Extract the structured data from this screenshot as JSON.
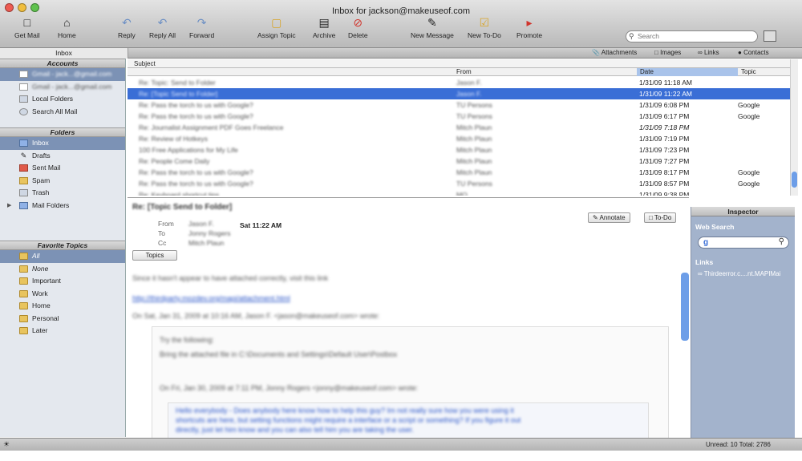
{
  "window": {
    "title": "Inbox for jackson@makeuseof.com"
  },
  "toolbar": {
    "get_mail": "Get Mail",
    "home": "Home",
    "reply": "Reply",
    "reply_all": "Reply All",
    "forward": "Forward",
    "assign_topic": "Assign Topic",
    "archive": "Archive",
    "delete": "Delete",
    "new_message": "New Message",
    "new_todo": "New To-Do",
    "promote": "Promote",
    "search_placeholder": "Search"
  },
  "tabs": {
    "inbox": "Inbox"
  },
  "filters": {
    "attachments": "Attachments",
    "images": "Images",
    "links": "Links",
    "contacts": "Contacts"
  },
  "sidebar": {
    "accounts_header": "Accounts",
    "accounts": [
      "Gmail - jack...@gmail.com",
      "Gmail - jack...@gmail.com",
      "Local Folders",
      "Search All Mail"
    ],
    "folders_header": "Folders",
    "folders": [
      "Inbox",
      "Drafts",
      "Sent Mail",
      "Spam",
      "Trash",
      "Mail Folders"
    ],
    "topics_header": "Favorite Topics",
    "topics": [
      "All",
      "None",
      "Important",
      "Work",
      "Home",
      "Personal",
      "Later"
    ]
  },
  "list": {
    "subject_header": "Subject",
    "from_header": "From",
    "date_header": "Date",
    "topic_header": "Topic",
    "rows": [
      {
        "subject": "Re: Topic: Send to Folder",
        "from": "Jason F.",
        "date": "1/31/09 11:18 AM",
        "topic": ""
      },
      {
        "subject": "Re: [Topic Send to Folder]",
        "from": "Jason F.",
        "date": "1/31/09 11:22 AM",
        "topic": ""
      },
      {
        "subject": "Re: Pass the torch to us with Google?",
        "from": "TU Persons",
        "date": "1/31/09 6:08 PM",
        "topic": "Google"
      },
      {
        "subject": "Re: Pass the torch to us with Google?",
        "from": "TU Persons",
        "date": "1/31/09 6:17 PM",
        "topic": "Google"
      },
      {
        "subject": "Re: Journalist Assignment PDF Goes Freelance",
        "from": "Mitch Plaun",
        "date": "1/31/09 7:18 PM",
        "topic": ""
      },
      {
        "subject": "Re: Review of Hotkeys",
        "from": "Mitch Plaun",
        "date": "1/31/09 7:19 PM",
        "topic": ""
      },
      {
        "subject": "100 Free Applications for My Life",
        "from": "Mitch Plaun",
        "date": "1/31/09 7:23 PM",
        "topic": ""
      },
      {
        "subject": "Re: People Come Daily",
        "from": "Mitch Plaun",
        "date": "1/31/09 7:27 PM",
        "topic": ""
      },
      {
        "subject": "Re: Pass the torch to us with Google?",
        "from": "Mitch Plaun",
        "date": "1/31/09 8:17 PM",
        "topic": "Google"
      },
      {
        "subject": "Re: Pass the torch to us with Google?",
        "from": "TU Persons",
        "date": "1/31/09 8:57 PM",
        "topic": "Google"
      },
      {
        "subject": "Re: Keyboard shortcut tips",
        "from": "MO",
        "date": "1/31/09 9:38 PM",
        "topic": ""
      }
    ]
  },
  "preview": {
    "subject": "Re: [Topic Send to Folder]",
    "from_label": "From",
    "to_label": "To",
    "cc_label": "Cc",
    "from_value": "Jason F.",
    "to_value": "Jonny Rogers",
    "cc_value": "Mitch Plaun",
    "time": "Sat 11:22 AM",
    "annotate": "Annotate",
    "todo": "To-Do",
    "topics": "Topics"
  },
  "inspector": {
    "header": "Inspector",
    "web_search_label": "Web Search",
    "links_label": "Links",
    "link_text": "Thirdeerror.c....nt.MAPIMai"
  },
  "status": {
    "counts": "Unread: 10  Total: 2786"
  }
}
